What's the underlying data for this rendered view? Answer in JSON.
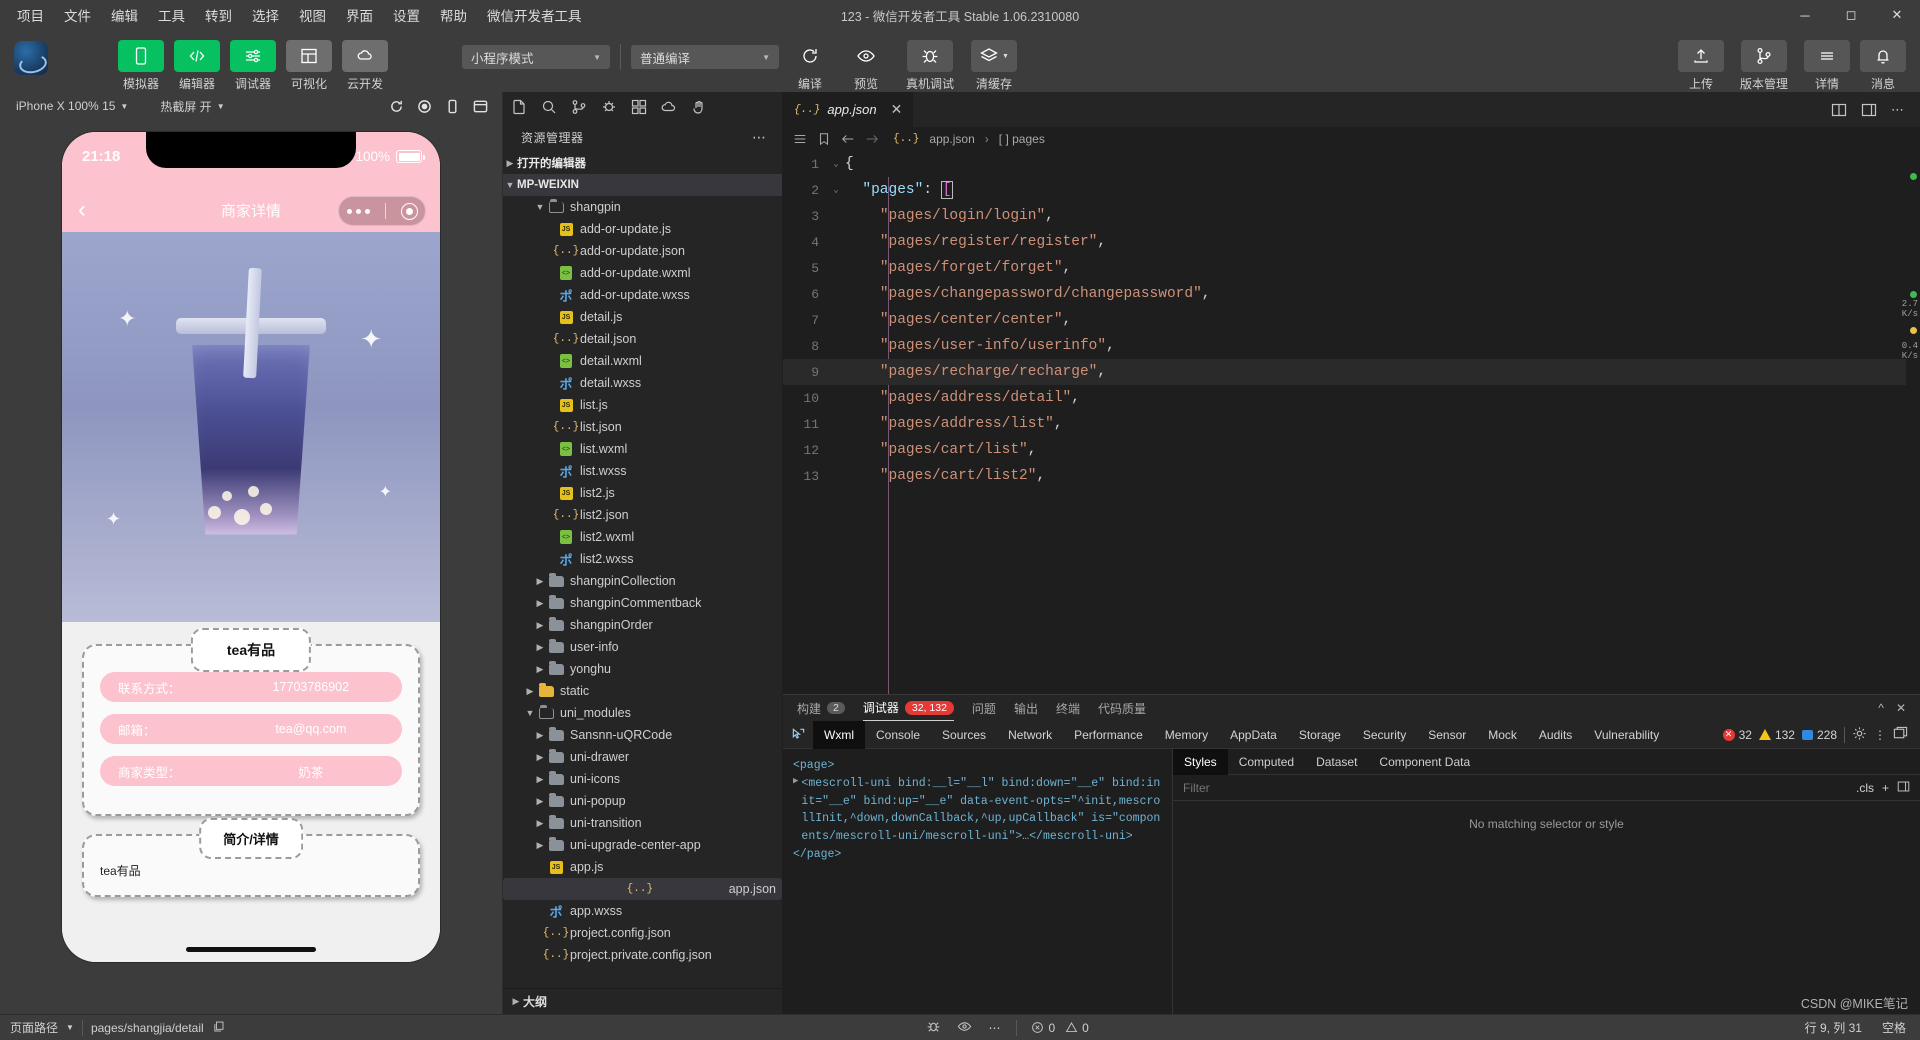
{
  "window": {
    "title": "123 - 微信开发者工具 Stable 1.06.2310080",
    "menu": [
      "项目",
      "文件",
      "编辑",
      "工具",
      "转到",
      "选择",
      "视图",
      "界面",
      "设置",
      "帮助",
      "微信开发者工具"
    ],
    "controls": [
      "minimize",
      "maximize",
      "close"
    ]
  },
  "toolbar": {
    "left_buttons": [
      {
        "label": "模拟器",
        "icon": "phone-icon",
        "style": "green"
      },
      {
        "label": "编辑器",
        "icon": "code-icon",
        "style": "green"
      },
      {
        "label": "调试器",
        "icon": "sliders-icon",
        "style": "green"
      },
      {
        "label": "可视化",
        "icon": "layout-icon",
        "style": "grey"
      },
      {
        "label": "云开发",
        "icon": "cloud-icon",
        "style": "grey"
      }
    ],
    "mode_select": "小程序模式",
    "compile_select": "普通编译",
    "center_buttons": [
      {
        "label": "编译",
        "icon": "refresh-icon"
      },
      {
        "label": "预览",
        "icon": "eye-icon"
      },
      {
        "label": "真机调试",
        "icon": "bug-icon"
      },
      {
        "label": "清缓存",
        "icon": "layers-icon"
      }
    ],
    "right_buttons": [
      {
        "label": "上传",
        "icon": "upload-icon"
      },
      {
        "label": "版本管理",
        "icon": "git-branch-icon"
      },
      {
        "label": "详情",
        "icon": "menu-icon"
      },
      {
        "label": "消息",
        "icon": "bell-icon"
      }
    ]
  },
  "simulator": {
    "device": "iPhone X 100% 15",
    "screenshot_label": "热截屏 开",
    "status_time": "21:18",
    "battery_percent": "100%",
    "nav_title": "商家详情",
    "shop_name": "tea有品",
    "rows": [
      {
        "key": "联系方式：",
        "value": "17703786902"
      },
      {
        "key": "邮箱：",
        "value": "tea@qq.com"
      },
      {
        "key": "商家类型：",
        "value": "奶茶"
      }
    ],
    "desc_title": "简介/详情",
    "desc_text": "tea有品"
  },
  "explorer": {
    "title": "资源管理器",
    "open_editors": "打开的编辑器",
    "project": "MP-WEIXIN",
    "outline": "大纲",
    "tree": [
      {
        "label": "shangpin",
        "type": "folder-open",
        "indent": 2,
        "arrow": "down"
      },
      {
        "label": "add-or-update.js",
        "type": "js",
        "indent": 3
      },
      {
        "label": "add-or-update.json",
        "type": "json",
        "indent": 3
      },
      {
        "label": "add-or-update.wxml",
        "type": "wxml",
        "indent": 3
      },
      {
        "label": "add-or-update.wxss",
        "type": "wxss",
        "indent": 3
      },
      {
        "label": "detail.js",
        "type": "js",
        "indent": 3
      },
      {
        "label": "detail.json",
        "type": "json",
        "indent": 3
      },
      {
        "label": "detail.wxml",
        "type": "wxml",
        "indent": 3
      },
      {
        "label": "detail.wxss",
        "type": "wxss",
        "indent": 3
      },
      {
        "label": "list.js",
        "type": "js",
        "indent": 3
      },
      {
        "label": "list.json",
        "type": "json",
        "indent": 3
      },
      {
        "label": "list.wxml",
        "type": "wxml",
        "indent": 3
      },
      {
        "label": "list.wxss",
        "type": "wxss",
        "indent": 3
      },
      {
        "label": "list2.js",
        "type": "js",
        "indent": 3
      },
      {
        "label": "list2.json",
        "type": "json",
        "indent": 3
      },
      {
        "label": "list2.wxml",
        "type": "wxml",
        "indent": 3
      },
      {
        "label": "list2.wxss",
        "type": "wxss",
        "indent": 3
      },
      {
        "label": "shangpinCollection",
        "type": "folder",
        "indent": 2,
        "arrow": "right"
      },
      {
        "label": "shangpinCommentback",
        "type": "folder",
        "indent": 2,
        "arrow": "right"
      },
      {
        "label": "shangpinOrder",
        "type": "folder",
        "indent": 2,
        "arrow": "right"
      },
      {
        "label": "user-info",
        "type": "folder",
        "indent": 2,
        "arrow": "right"
      },
      {
        "label": "yonghu",
        "type": "folder",
        "indent": 2,
        "arrow": "right"
      },
      {
        "label": "static",
        "type": "folder-yellow",
        "indent": 1,
        "arrow": "right"
      },
      {
        "label": "uni_modules",
        "type": "folder-open",
        "indent": 1,
        "arrow": "down"
      },
      {
        "label": "Sansnn-uQRCode",
        "type": "folder",
        "indent": 2,
        "arrow": "right"
      },
      {
        "label": "uni-drawer",
        "type": "folder",
        "indent": 2,
        "arrow": "right"
      },
      {
        "label": "uni-icons",
        "type": "folder",
        "indent": 2,
        "arrow": "right"
      },
      {
        "label": "uni-popup",
        "type": "folder",
        "indent": 2,
        "arrow": "right"
      },
      {
        "label": "uni-transition",
        "type": "folder",
        "indent": 2,
        "arrow": "right"
      },
      {
        "label": "uni-upgrade-center-app",
        "type": "folder",
        "indent": 2,
        "arrow": "right"
      },
      {
        "label": "app.js",
        "type": "js",
        "indent": 2
      },
      {
        "label": "app.json",
        "type": "json",
        "indent": 2,
        "selected": true
      },
      {
        "label": "app.wxss",
        "type": "wxss",
        "indent": 2
      },
      {
        "label": "project.config.json",
        "type": "json",
        "indent": 2
      },
      {
        "label": "project.private.config.json",
        "type": "json",
        "indent": 2
      }
    ]
  },
  "editor": {
    "tab": "app.json",
    "tab_icon": "json-icon",
    "breadcrumb": [
      "app.json",
      "[ ] pages"
    ],
    "lines": [
      {
        "n": "1",
        "text": "{",
        "fold": "down"
      },
      {
        "n": "2",
        "text": "\"pages\": [",
        "fold": "down"
      },
      {
        "n": "3",
        "text": "\"pages/login/login\","
      },
      {
        "n": "4",
        "text": "\"pages/register/register\","
      },
      {
        "n": "5",
        "text": "\"pages/forget/forget\","
      },
      {
        "n": "6",
        "text": "\"pages/changepassword/changepassword\","
      },
      {
        "n": "7",
        "text": "\"pages/center/center\","
      },
      {
        "n": "8",
        "text": "\"pages/user-info/userinfo\","
      },
      {
        "n": "9",
        "text": "\"pages/recharge/recharge\",",
        "current": true
      },
      {
        "n": "10",
        "text": "\"pages/address/detail\","
      },
      {
        "n": "11",
        "text": "\"pages/address/list\","
      },
      {
        "n": "12",
        "text": "\"pages/cart/list\","
      },
      {
        "n": "13",
        "text": "\"pages/cart/list2\","
      }
    ],
    "net_up": "2.7",
    "net_up_unit": "K/s",
    "net_down": "0.4",
    "net_down_unit": "K/s"
  },
  "devtools": {
    "panel_tabs": [
      {
        "label": "构建",
        "badge": "2",
        "badge_type": "grey"
      },
      {
        "label": "调试器",
        "badge": "32, 132",
        "badge_type": "red",
        "active": true
      },
      {
        "label": "问题"
      },
      {
        "label": "输出"
      },
      {
        "label": "终端"
      },
      {
        "label": "代码质量"
      }
    ],
    "inspector_tabs": [
      "Wxml",
      "Console",
      "Sources",
      "Network",
      "Performance",
      "Memory",
      "AppData",
      "Storage",
      "Security",
      "Sensor",
      "Mock",
      "Audits",
      "Vulnerability"
    ],
    "active_inspector_tab": "Wxml",
    "counts": {
      "errors": "32",
      "warnings": "132",
      "info": "228"
    },
    "wxml_lines": [
      "<page>",
      "<mescroll-uni bind:__l=\"__l\" bind:down=\"__e\" bind:init=\"__e\" bind:up=\"__e\" data-event-opts=\"^init,mescrollInit,^down,downCallback,^up,upCallback\" is=\"components/mescroll-uni/mescroll-uni\">…</mescroll-uni>",
      "</page>"
    ],
    "style_tabs": [
      "Styles",
      "Computed",
      "Dataset",
      "Component Data"
    ],
    "active_style_tab": "Styles",
    "filter_placeholder": "Filter",
    "cls_label": ".cls",
    "no_match": "No matching selector or style"
  },
  "statusbar": {
    "page_path_label": "页面路径",
    "page_path": "pages/shangjia/detail",
    "errors": "0",
    "warnings": "0",
    "cursor": "行 9, 列 31",
    "spaces": "空格",
    "watermark": "CSDN @MIKE笔记"
  }
}
